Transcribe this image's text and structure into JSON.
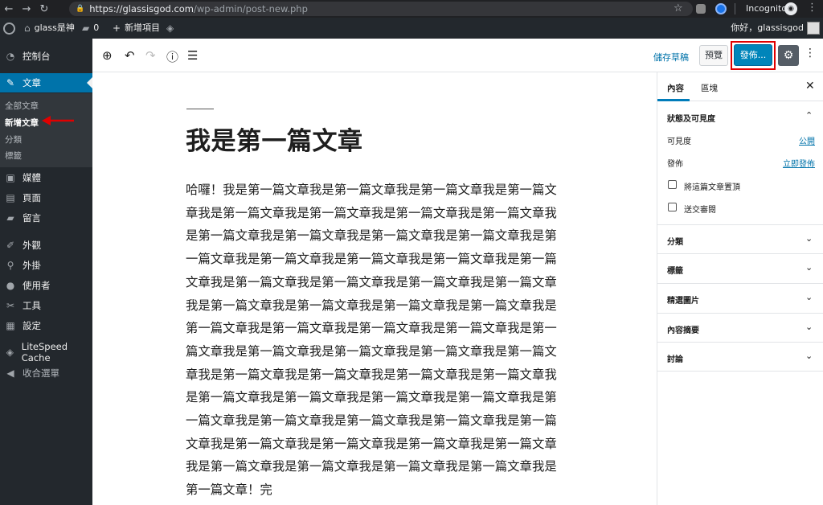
{
  "browser": {
    "url_host": "https://glassisgod.com",
    "url_path": "/wp-admin/post-new.php",
    "incognito_label": "Incognito"
  },
  "adminbar": {
    "site_name": "glass是神",
    "comments_count": "0",
    "new_item": "新增項目",
    "greeting": "你好，glassisgod"
  },
  "sidebar": {
    "items": [
      {
        "label": "控制台",
        "icon": "dashboard-icon"
      },
      {
        "label": "文章",
        "icon": "pin-icon",
        "active": true
      },
      {
        "label": "媒體",
        "icon": "media-icon"
      },
      {
        "label": "頁面",
        "icon": "page-icon"
      },
      {
        "label": "留言",
        "icon": "comment-icon"
      },
      {
        "label": "外觀",
        "icon": "brush-icon"
      },
      {
        "label": "外掛",
        "icon": "plugin-icon"
      },
      {
        "label": "使用者",
        "icon": "user-icon"
      },
      {
        "label": "工具",
        "icon": "wrench-icon"
      },
      {
        "label": "設定",
        "icon": "settings-icon"
      },
      {
        "label": "LiteSpeed Cache",
        "icon": "diamond-icon"
      },
      {
        "label": "收合選單",
        "icon": "collapse-icon"
      }
    ],
    "submenu": [
      "全部文章",
      "新增文章",
      "分類",
      "標籤"
    ]
  },
  "toolbar": {
    "save_draft": "儲存草稿",
    "preview": "預覽",
    "publish": "發佈..."
  },
  "post": {
    "title": "我是第一篇文章",
    "body": "哈囉！我是第一篇文章我是第一篇文章我是第一篇文章我是第一篇文章我是第一篇文章我是第一篇文章我是第一篇文章我是第一篇文章我是第一篇文章我是第一篇文章我是第一篇文章我是第一篇文章我是第一篇文章我是第一篇文章我是第一篇文章我是第一篇文章我是第一篇文章我是第一篇文章我是第一篇文章我是第一篇文章我是第一篇文章我是第一篇文章我是第一篇文章我是第一篇文章我是第一篇文章我是第一篇文章我是第一篇文章我是第一篇文章我是第一篇文章我是第一篇文章我是第一篇文章我是第一篇文章我是第一篇文章我是第一篇文章我是第一篇文章我是第一篇文章我是第一篇文章我是第一篇文章我是第一篇文章我是第一篇文章我是第一篇文章我是第一篇文章我是第一篇文章我是第一篇文章我是第一篇文章我是第一篇文章我是第一篇文章我是第一篇文章我是第一篇文章我是第一篇文章我是第一篇文章我是第一篇文章我是第一篇文章我是第一篇文章我是第一篇文章我是第一篇文章！完"
  },
  "panel": {
    "tab_document": "內容",
    "tab_block": "區塊",
    "status_title": "狀態及可見度",
    "visibility_label": "可見度",
    "visibility_value": "公開",
    "publish_label": "發佈",
    "publish_value": "立即發佈",
    "sticky_label": "將這篇文章置頂",
    "pending_label": "送交審閱",
    "sections": [
      "分類",
      "標籤",
      "精選圖片",
      "內容摘要",
      "討論"
    ]
  },
  "colors": {
    "accent": "#0073aa",
    "publish": "#0085ba",
    "highlight": "#e00000",
    "admin_dark": "#23282d"
  }
}
